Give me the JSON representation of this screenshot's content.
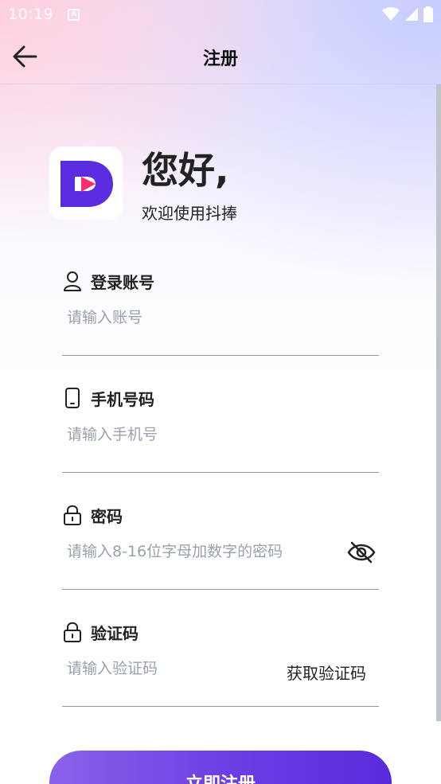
{
  "status_bar": {
    "time": "10:19",
    "notif_glyph": "A"
  },
  "nav": {
    "title": "注册"
  },
  "greeting": {
    "title": "您好,",
    "subtitle": "欢迎使用抖捧"
  },
  "fields": [
    {
      "label": "登录账号",
      "placeholder": "请输入账号",
      "icon": "user-icon"
    },
    {
      "label": "手机号码",
      "placeholder": "请输入手机号",
      "icon": "phone-icon"
    },
    {
      "label": "密码",
      "placeholder": "请输入8-16位字母加数字的密码",
      "icon": "lock-icon"
    },
    {
      "label": "验证码",
      "placeholder": "请输入验证码",
      "icon": "lock-icon"
    }
  ],
  "get_code_label": "获取验证码",
  "submit_label": "立即注册",
  "colors": {
    "accent": "#6a3de3",
    "logo": "#5b2ce0",
    "play": "#ff2d6f"
  }
}
